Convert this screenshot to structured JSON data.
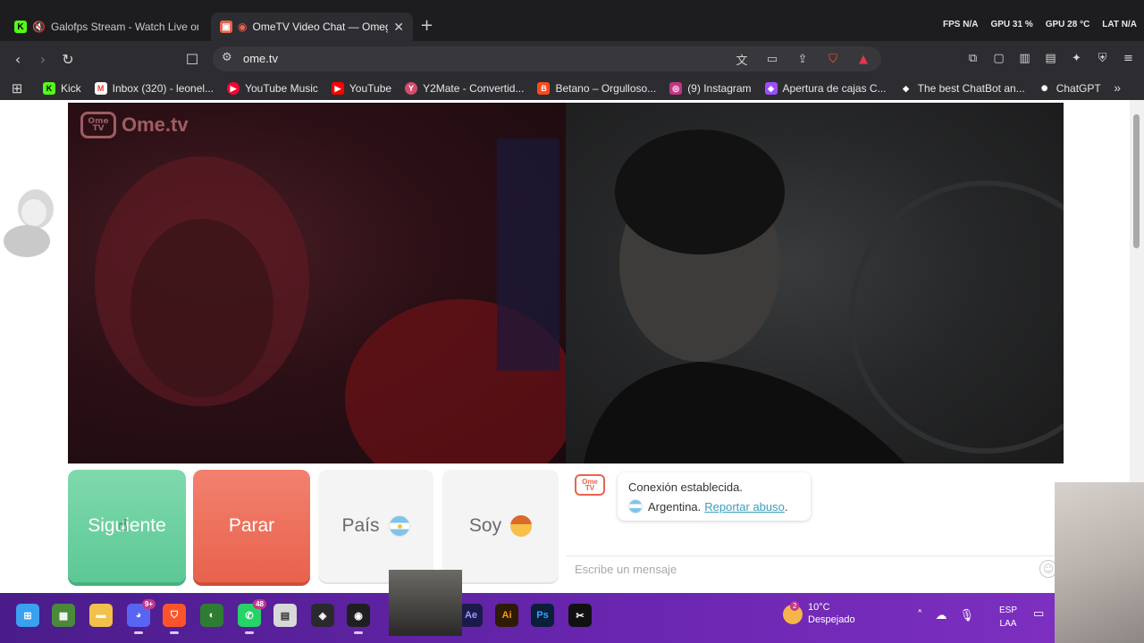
{
  "browser": {
    "tabs": [
      {
        "title": "Galofps Stream - Watch Live on K",
        "icon": "kick-icon",
        "color": "#53fc18",
        "active": false
      },
      {
        "title": "OmeTV Video Chat — Omegl",
        "icon": "ometv-icon",
        "color": "#e8634d",
        "active": true
      }
    ],
    "stats": {
      "fps": "FPS N/A",
      "gpu": "GPU 31 %",
      "gpu_temp": "GPU 28 °C",
      "lat": "LAT N/A"
    },
    "url": "ome.tv",
    "bookmarks": [
      {
        "label": "Kick",
        "icon": "kick-icon",
        "color": "#53fc18"
      },
      {
        "label": "Inbox (320) - leonel...",
        "icon": "gmail-icon",
        "color": "#ea4335"
      },
      {
        "label": "YouTube Music",
        "icon": "youtube-music-icon",
        "color": "#ff0033"
      },
      {
        "label": "YouTube",
        "icon": "youtube-icon",
        "color": "#ff0000"
      },
      {
        "label": "Y2Mate - Convertid...",
        "icon": "y2mate-icon",
        "color": "#d54b6d"
      },
      {
        "label": "Betano – Orgulloso...",
        "icon": "betano-icon",
        "color": "#ff4a1c"
      },
      {
        "label": "(9) Instagram",
        "icon": "instagram-icon",
        "color": "#c13584"
      },
      {
        "label": "Apertura de cajas C...",
        "icon": "cases-icon",
        "color": "#9b4dff"
      },
      {
        "label": "The best ChatBot an...",
        "icon": "chatbot-icon",
        "color": "#ffffff"
      },
      {
        "label": "ChatGPT",
        "icon": "chatgpt-icon",
        "color": "#ffffff"
      }
    ]
  },
  "ometv": {
    "logo_text": "Ome.tv",
    "buttons": {
      "next": "Siguiente",
      "stop": "Parar",
      "country": "País",
      "gender": "Soy"
    },
    "chat": {
      "message_line1": "Conexión establecida.",
      "country": "Argentina.",
      "report_link": "Reportar abuso",
      "placeholder": "Escribe un mensaje"
    }
  },
  "taskbar": {
    "weather": {
      "temp": "10°C",
      "condition": "Despejado",
      "badge": "2"
    },
    "lang": {
      "line1": "ESP",
      "line2": "LAA"
    },
    "whatsapp_badge": "48",
    "discord_badge": "9+",
    "apps": [
      "windows-start",
      "minecraft",
      "file-explorer",
      "discord",
      "brave",
      "ultra",
      "whatsapp",
      "notepad",
      "davinci-resolve",
      "obs",
      "after-effects",
      "illustrator",
      "photoshop",
      "capcut"
    ]
  }
}
